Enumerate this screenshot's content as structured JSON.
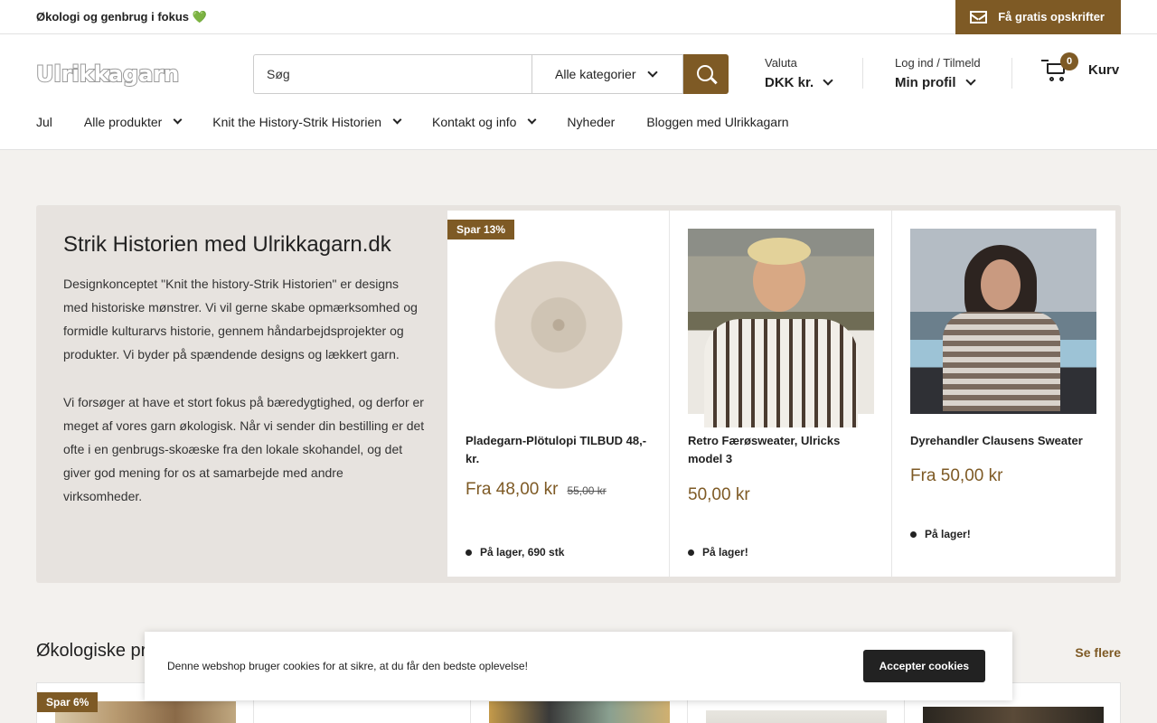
{
  "topbar": {
    "tagline": "Økologi og genbrug i fokus 💚",
    "recipes_label": "Få gratis opskrifter"
  },
  "header": {
    "logo": "Ulrikkagarn",
    "search_placeholder": "Søg",
    "category_label": "Alle kategorier",
    "currency_label": "Valuta",
    "currency_value": "DKK kr.",
    "account_label": "Log ind / Tilmeld",
    "account_value": "Min profil",
    "cart_count": "0",
    "cart_label": "Kurv"
  },
  "nav": [
    {
      "label": "Jul",
      "dropdown": false
    },
    {
      "label": "Alle produkter",
      "dropdown": true
    },
    {
      "label": "Knit the History-Strik Historien",
      "dropdown": true
    },
    {
      "label": "Kontakt og info",
      "dropdown": true
    },
    {
      "label": "Nyheder",
      "dropdown": false
    },
    {
      "label": "Bloggen med Ulrikkagarn",
      "dropdown": false
    }
  ],
  "hero": {
    "title": "Strik Historien med Ulrikkagarn.dk",
    "paragraph1": "Designkonceptet \"Knit the history-Strik Historien\" er designs med historiske mønstrer. Vi vil gerne skabe opmærksomhed og formidle kulturarvs historie, gennem håndarbejdsprojekter og produkter. Vi byder på spændende designs og lækkert garn.",
    "paragraph2": "Vi forsøger at have et stort fokus på bæredygtighed, og derfor er meget af vores garn økologisk. Når vi sender din bestilling er det ofte i en genbrugs-skoæske fra den lokale skohandel, og det giver god mening for os at samarbejde med andre virksomheder."
  },
  "products": [
    {
      "discount": "Spar 13%",
      "name": "Pladegarn-Plötulopi TILBUD 48,- kr.",
      "price": "Fra 48,00 kr",
      "old_price": "55,00 kr",
      "stock": "På lager, 690 stk"
    },
    {
      "discount": "",
      "name": "Retro Færøsweater, Ulricks model 3",
      "price": "50,00 kr",
      "old_price": "",
      "stock": "På lager!"
    },
    {
      "discount": "",
      "name": "Dyrehandler Clausens Sweater",
      "price": "Fra 50,00 kr",
      "old_price": "",
      "stock": "På lager!"
    }
  ],
  "section": {
    "title": "Økologiske produkter",
    "see_more": "Se flere",
    "first_discount": "Spar 6%"
  },
  "cookie": {
    "message": "Denne webshop bruger cookies for at sikre, at du får den bedste oplevelse!",
    "accept": "Accepter cookies"
  }
}
